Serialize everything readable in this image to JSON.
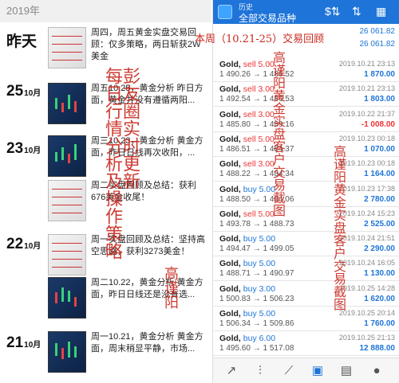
{
  "left": {
    "year": "2019年",
    "entries": [
      {
        "day": "昨天",
        "month": "",
        "posts": [
          {
            "text": "周四，周五黄金实盘交易回顾：仅多策略，两日斩获2W美金",
            "thumb": "light"
          }
        ]
      },
      {
        "day": "25",
        "month": "10月",
        "posts": [
          {
            "text": "周五10.25，黄金分析 昨日方面，黄金并没有遵循两阳...",
            "thumb": "dark"
          }
        ]
      },
      {
        "day": "23",
        "month": "10月",
        "posts": [
          {
            "text": "周三10.23，黄金分析 黄金方面，昨日日线再次收阳，...",
            "thumb": "dark"
          },
          {
            "text": "周二实盘回顾及总结：获利676美金收尾！",
            "thumb": "light"
          }
        ]
      },
      {
        "day": "22",
        "month": "10月",
        "posts": [
          {
            "text": "周一实盘回顾及总结：坚持高空思路，获利3273美金！",
            "thumb": "light"
          },
          {
            "text": "周二10.22，黄金分析 黄金方面，昨日日线还是没有选...",
            "thumb": "dark"
          }
        ]
      },
      {
        "day": "21",
        "month": "10月",
        "posts": [
          {
            "text": "周一10.21，黄金分析 黄金方面，周末稍显平静，市场...",
            "thumb": "dark"
          }
        ]
      }
    ],
    "handwriting": {
      "col1": "每日行情分析及操作策略",
      "col2": "彭友圈实时更新",
      "col3": "高谨阳"
    }
  },
  "right": {
    "header": {
      "subtitle": "历史",
      "title": "全部交易品种"
    },
    "summary": [
      "26 061.82",
      "26 061.82"
    ],
    "banner": "本周（10.21-25）交易回顾",
    "handwriting": {
      "col1": "高谨阳黄金实盘客户交易截图",
      "col2": "高谨阳黄金实盘客户交易截图"
    },
    "trades": [
      {
        "sym": "Gold,",
        "side": "sell 5.00",
        "dir": "sell",
        "from": "1 490.26",
        "to": "1 486.52",
        "time": "2019.10.21 23:13",
        "pl": "1 870.00",
        "neg": false
      },
      {
        "sym": "Gold,",
        "side": "sell 3.00",
        "dir": "sell",
        "from": "1 492.54",
        "to": "1 486.53",
        "time": "2019.10.21 23:13",
        "pl": "1 803.00",
        "neg": false
      },
      {
        "sym": "Gold,",
        "side": "sell 3.00",
        "dir": "sell",
        "from": "1 485.80",
        "to": "1 489.16",
        "time": "2019.10.22 21:37",
        "pl": "-1 008.00",
        "neg": true
      },
      {
        "sym": "Gold,",
        "side": "sell 5.00",
        "dir": "sell",
        "from": "1 486.51",
        "to": "1 484.37",
        "time": "2019.10.23 00:18",
        "pl": "1 070.00",
        "neg": false
      },
      {
        "sym": "Gold,",
        "side": "sell 3.00",
        "dir": "sell",
        "from": "1 488.22",
        "to": "1 484.34",
        "time": "2019.10.23 00:18",
        "pl": "1 164.00",
        "neg": false
      },
      {
        "sym": "Gold,",
        "side": "buy 5.00",
        "dir": "buy",
        "from": "1 488.50",
        "to": "1 494.06",
        "time": "2019.10.23 17:38",
        "pl": "2 780.00",
        "neg": false
      },
      {
        "sym": "Gold,",
        "side": "sell 5.00",
        "dir": "sell",
        "from": "1 493.78",
        "to": "1 488.73",
        "time": "2019.10.24 15:23",
        "pl": "2 525.00",
        "neg": false
      },
      {
        "sym": "Gold,",
        "side": "buy 5.00",
        "dir": "buy",
        "from": "1 494.47",
        "to": "1 499.05",
        "time": "2019.10.24 21:51",
        "pl": "2 290.00",
        "neg": false
      },
      {
        "sym": "Gold,",
        "side": "buy 5.00",
        "dir": "buy",
        "from": "1 488.71",
        "to": "1 490.97",
        "time": "2019.10.24 16:05",
        "pl": "1 130.00",
        "neg": false
      },
      {
        "sym": "Gold,",
        "side": "buy 3.00",
        "dir": "buy",
        "from": "1 500.83",
        "to": "1 506.23",
        "time": "2019.10.25 14:28",
        "pl": "1 620.00",
        "neg": false
      },
      {
        "sym": "Gold,",
        "side": "buy 5.00",
        "dir": "buy",
        "from": "1 506.34",
        "to": "1 509.86",
        "time": "2019.10.25 20:14",
        "pl": "1 760.00",
        "neg": false
      },
      {
        "sym": "Gold,",
        "side": "buy 6.00",
        "dir": "buy",
        "from": "1 495.60",
        "to": "1 517.08",
        "time": "2019.10.25 21:13",
        "pl": "12 888.00",
        "neg": false
      }
    ],
    "tabs": [
      "trade-chart-icon",
      "candles-icon",
      "line-chart-icon",
      "inbox-icon",
      "news-icon",
      "chat-icon"
    ]
  }
}
